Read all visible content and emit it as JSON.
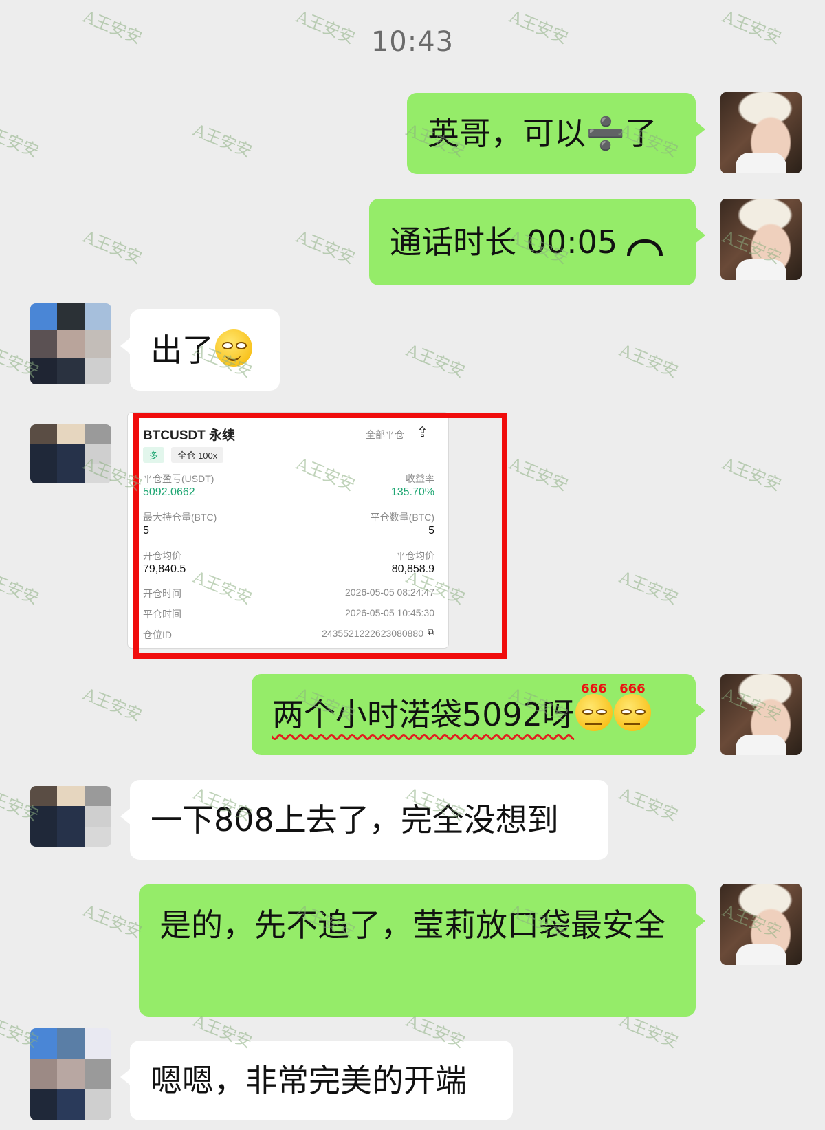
{
  "time": "10:43",
  "watermark": "A王安安",
  "messages": [
    {
      "side": "me",
      "text": "英哥，可以➗了"
    },
    {
      "side": "me",
      "text": "通话时长 00:05",
      "icon": "hang-up-phone-icon"
    },
    {
      "side": "other",
      "text": "出了",
      "emoji": "grinning-face"
    },
    {
      "side": "me",
      "text": "两个小时渃袋5092呀",
      "emoji_badge": "666"
    },
    {
      "side": "other",
      "text": "一下808上去了，完全没想到"
    },
    {
      "side": "me",
      "text": "是的，先不追了，莹莉放口袋最安全"
    },
    {
      "side": "other",
      "text": "嗯嗯，非常完美的开端"
    }
  ],
  "trade_card": {
    "title": "BTCUSDT 永续",
    "close_all": "全部平仓",
    "direction_tag": "多",
    "margin_tag": "全仓 100x",
    "pnl_label": "平仓盈亏(USDT)",
    "pnl_value": "5092.0662",
    "roi_label": "收益率",
    "roi_value": "135.70%",
    "max_pos_label": "最大持仓量(BTC)",
    "max_pos_value": "5",
    "close_qty_label": "平仓数量(BTC)",
    "close_qty_value": "5",
    "open_avg_label": "开仓均价",
    "open_avg_value": "79,840.5",
    "close_avg_label": "平仓均价",
    "close_avg_value": "80,858.9",
    "open_time_label": "开仓时间",
    "open_time_value": "2026-05-05 08:24:47",
    "close_time_label": "平仓时间",
    "close_time_value": "2026-05-05 10:45:30",
    "position_id_label": "仓位ID",
    "position_id_value": "2435521222623080880"
  },
  "colors": {
    "bubble_me": "#95ec69",
    "bubble_other": "#ffffff",
    "highlight_frame": "#f00c0c",
    "profit_green": "#1ea672"
  }
}
